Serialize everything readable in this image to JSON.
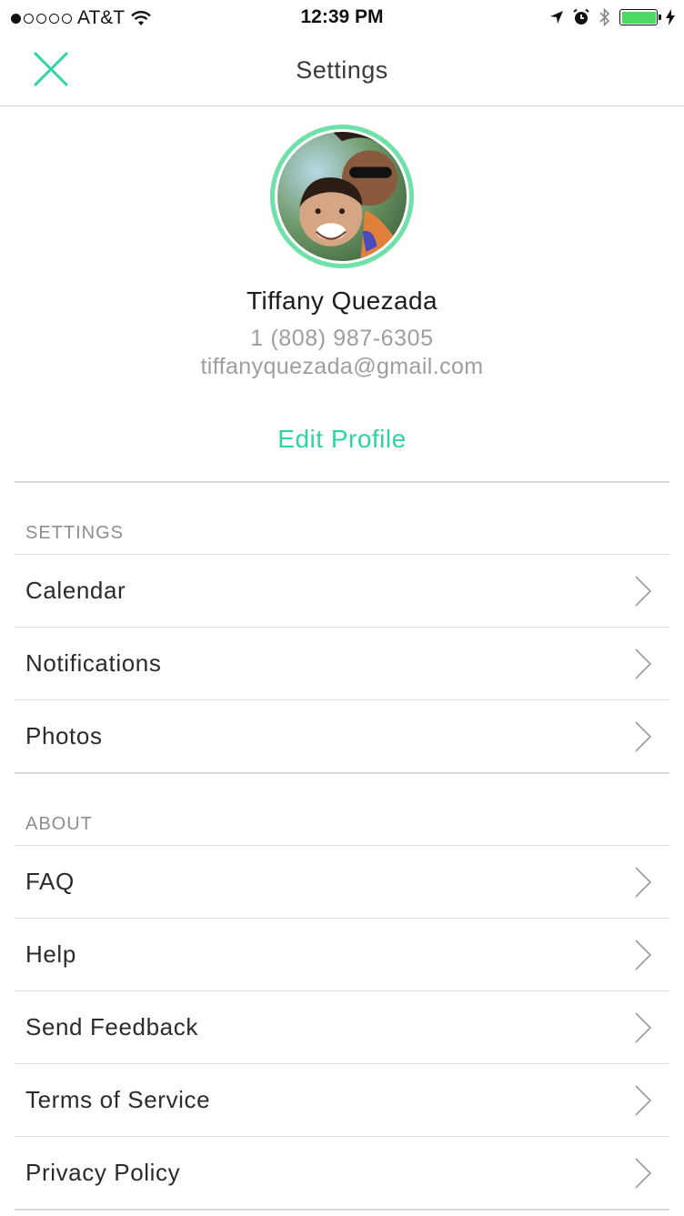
{
  "status_bar": {
    "carrier": "AT&T",
    "time": "12:39 PM",
    "battery_color": "#4cd964"
  },
  "nav": {
    "title": "Settings",
    "close_icon": "close-icon"
  },
  "profile": {
    "name": "Tiffany Quezada",
    "phone": "1 (808) 987-6305",
    "email": "tiffanyquezada@gmail.com",
    "edit_label": "Edit Profile",
    "accent_color": "#2ed3a2",
    "ring_color": "#6ee0a8"
  },
  "sections": {
    "settings": {
      "header": "SETTINGS",
      "items": [
        "Calendar",
        "Notifications",
        "Photos"
      ]
    },
    "about": {
      "header": "ABOUT",
      "items": [
        "FAQ",
        "Help",
        "Send Feedback",
        "Terms of Service",
        "Privacy Policy"
      ]
    }
  }
}
